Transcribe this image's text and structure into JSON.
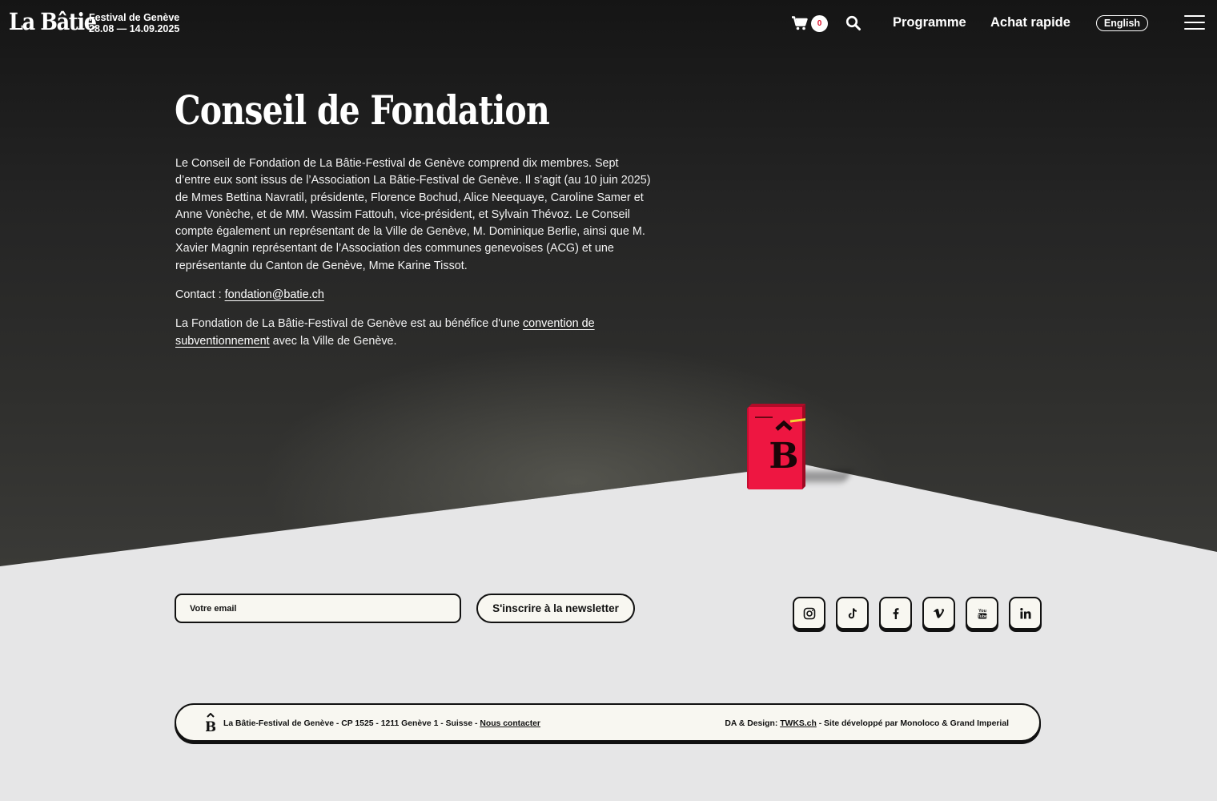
{
  "header": {
    "logo_text": "La Bâtie",
    "festival_name": "Festival de Genève",
    "festival_dates": "28.08 — 14.09.2025",
    "cart_count": "0",
    "nav": {
      "programme": "Programme",
      "achat_rapide": "Achat rapide",
      "language": "English"
    }
  },
  "main": {
    "title": "Conseil de Fondation",
    "paragraph1": "Le Conseil de Fondation de La Bâtie-Festival de Genève comprend dix membres. Sept d’entre eux sont issus de l’Association La Bâtie-Festival de Genève. Il s’agit (au 10 juin 2025) de Mmes Bettina Navratil, présidente, Florence Bochud, Alice Neequaye, Caroline Samer et Anne Vonèche, et de MM. Wassim Fattouh, vice-président, et Sylvain Thévoz. Le Conseil compte également un représentant de la Ville de Genève, M. Dominique Berlie, ainsi que M. Xavier Magnin représentant de l’Association des communes genevoises (ACG) et une représentante du Canton de Genève, Mme Karine Tissot.",
    "contact_prefix": "Contact : ",
    "contact_email": "fondation@batie.ch",
    "paragraph3_prefix": "La Fondation de La Bâtie-Festival de Genève est au bénéfice d'une ",
    "paragraph3_link": "convention de subventionnement",
    "paragraph3_suffix": " avec la Ville de Genève."
  },
  "newsletter": {
    "email_placeholder": "Votre email",
    "email_value": "",
    "subscribe_label": "S'inscrire à la newsletter"
  },
  "socials": [
    "instagram-icon",
    "tiktok-icon",
    "facebook-icon",
    "vimeo-icon",
    "youtube-icon",
    "linkedin-icon"
  ],
  "footer": {
    "address": "La Bâtie-Festival de Genève - CP 1525 - 1211 Genève 1 - Suisse - ",
    "contact_link": "Nous contacter",
    "credits_prefix": "DA & Design: ",
    "credits_link": "TWKS.ch",
    "credits_suffix": " - Site développé par Monoloco & Grand Imperial"
  },
  "colors": {
    "accent_red": "#e8103a",
    "badge_red": "#e0102a",
    "paper": "#f8f7f1",
    "floor": "#e6e6e7",
    "dark": "#1a1a1a"
  }
}
